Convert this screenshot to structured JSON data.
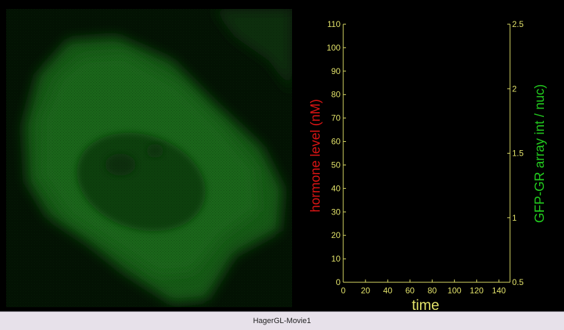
{
  "colors": {
    "axis": "#e3e36a",
    "hormone": "#d81414",
    "gfp": "#22c81e",
    "background": "#000000",
    "footer_bg": "#e7e1ea"
  },
  "image_panel": {
    "description_icon": "microscopy-image"
  },
  "chart_data": {
    "type": "line",
    "x": [],
    "xlabel": "time",
    "xlim": [
      0,
      150
    ],
    "xticks": [
      0,
      20,
      40,
      60,
      80,
      100,
      120,
      140
    ],
    "series": [
      {
        "axis": "left",
        "x": [],
        "values": []
      },
      {
        "axis": "right",
        "x": [],
        "values": []
      }
    ],
    "ylabel_left": "hormone level (nM)",
    "ylim_left": [
      0,
      110
    ],
    "yticks_left": [
      0,
      10,
      20,
      30,
      40,
      50,
      60,
      70,
      80,
      90,
      100,
      110
    ],
    "ylabel_right": "GFP-GR array int / nuc)",
    "ylim_right": [
      0.5,
      2.5
    ],
    "yticks_right": [
      0.5,
      1,
      1.5,
      2,
      2.5
    ],
    "grid": false
  },
  "footer": {
    "label": "HagerGL-Movie1"
  }
}
